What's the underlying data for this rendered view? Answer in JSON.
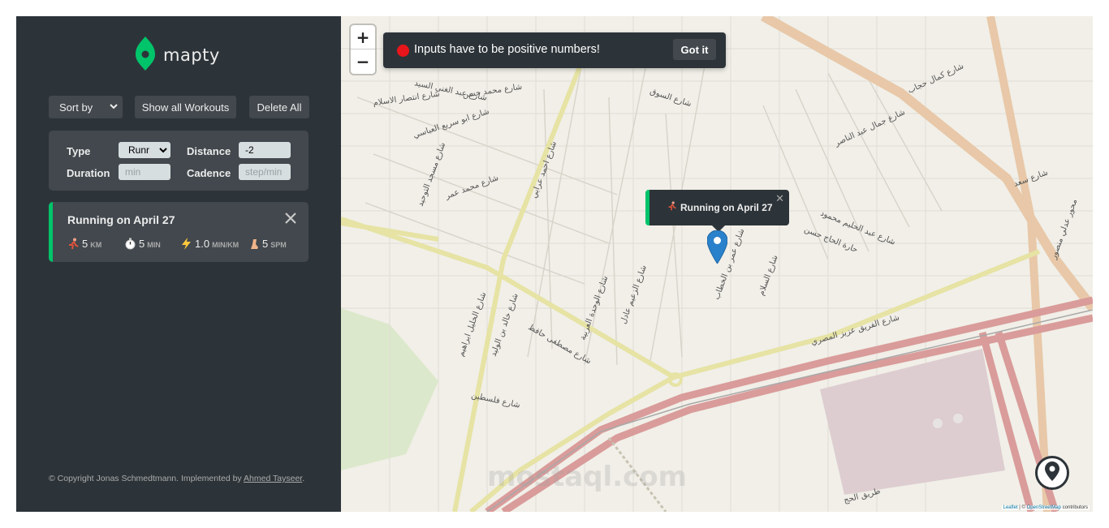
{
  "sidebar": {
    "logo_text": "mapty",
    "controls": {
      "sort_label": "Sort by",
      "show_all_label": "Show all Workouts",
      "delete_all_label": "Delete All"
    },
    "form": {
      "type_label": "Type",
      "type_value": "Runr",
      "distance_label": "Distance",
      "distance_value": "-2",
      "duration_label": "Duration",
      "duration_placeholder": "min",
      "cadence_label": "Cadence",
      "cadence_placeholder": "step/min"
    },
    "workout": {
      "title": "Running on April 27",
      "distance_value": "5",
      "distance_unit": "KM",
      "duration_value": "5",
      "duration_unit": "MIN",
      "pace_value": "1.0",
      "pace_unit": "MIN/KM",
      "cadence_value": "5",
      "cadence_unit": "SPM",
      "accent_color": "#00c46a"
    },
    "copyright_prefix": "© Copyright Jonas Schmedtmann. Implemented by ",
    "copyright_link": "Ahmed Tayseer",
    "copyright_suffix": "."
  },
  "map": {
    "zoom_in": "+",
    "zoom_out": "−",
    "toast_text": "Inputs have to be positive numbers!",
    "toast_button": "Got it",
    "popup_text": "Running on April 27",
    "popup_close": "✕",
    "attribution_leaflet": "Leaflet",
    "attribution_sep": " | © ",
    "attribution_osm": "OpenStreetMap",
    "attribution_suffix": " contributors",
    "watermark": "mostaql.com",
    "street_labels": [
      "شارع السوق",
      "شارع عبد الغني السيد",
      "شارع انتصار الاسلام",
      "شارع ابو سريع العباسي",
      "شارع مسجد التوحيد",
      "شارع محمد عمر",
      "شارع احمد عرابي",
      "شارع عبد الحليم محمود",
      "حارة الحاج حسن",
      "شارع جمال عبد الناصر",
      "شارع الفريق عزيز المصري",
      "شارع مصطفى حافظ",
      "شارع فلسطين",
      "شارع الخليل ابراهيم",
      "شارع خالد بن الوليد",
      "شارع عمر بن الخطاب",
      "شارع السلام",
      "شارع الزعيم عادل",
      "شارع الوحدة العربية",
      "شارع كمال حجاب",
      "شارع محمد حسن",
      "محور عدلي منصور",
      "شارع سعد",
      "طريق الحج"
    ],
    "colors": {
      "land": "#f1efe8",
      "major_road": "#d99c9a",
      "secondary_road": "#e6e3a4",
      "trunk": "#e8c8a8",
      "block_area": "#ddcdd0",
      "park": "#d7e6c3",
      "marker": "#2a81cb"
    }
  }
}
